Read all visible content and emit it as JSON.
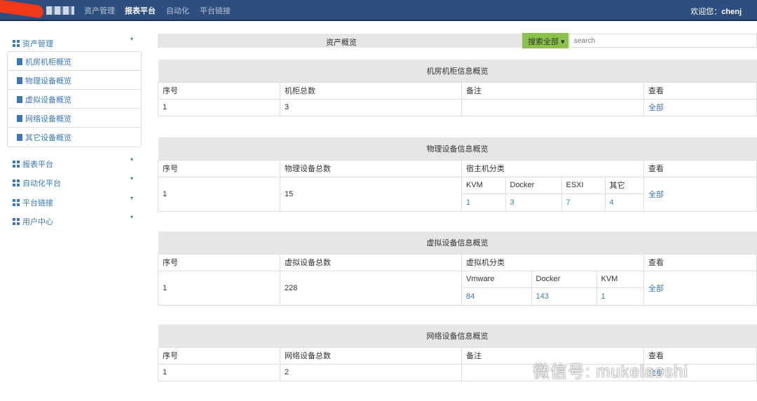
{
  "nav": {
    "items": [
      "资产管理",
      "报表平台",
      "自动化",
      "平台链接"
    ],
    "active": 1,
    "welcome_label": "欢迎您：",
    "user": "chenj"
  },
  "sidebar": {
    "groups": [
      {
        "label": "资产管理",
        "items": [
          "机房机柜概览",
          "物理设备概览",
          "虚拟设备概览",
          "网络设备概览",
          "其它设备概览"
        ]
      },
      {
        "label": "报表平台"
      },
      {
        "label": "自动化平台"
      },
      {
        "label": "平台链接"
      },
      {
        "label": "用户中心"
      }
    ]
  },
  "overview": {
    "title": "资产概览",
    "search_button": "搜索全部",
    "search_placeholder": "search"
  },
  "cabinet": {
    "title": "机房机柜信息概览",
    "headers": [
      "序号",
      "机柜总数",
      "备注",
      "查看"
    ],
    "row": {
      "no": "1",
      "total": "3",
      "note": "",
      "view": "全部"
    }
  },
  "physical": {
    "title": "物理设备信息概览",
    "headers": [
      "序号",
      "物理设备总数",
      "宿主机分类",
      "查看"
    ],
    "row": {
      "no": "1",
      "total": "15",
      "view": "全部"
    },
    "sub_headers": [
      "KVM",
      "Docker",
      "ESXI",
      "其它"
    ],
    "sub_values": [
      "1",
      "3",
      "7",
      "4"
    ]
  },
  "virtual": {
    "title": "虚拟设备信息概览",
    "headers": [
      "序号",
      "虚拟设备总数",
      "虚拟机分类",
      "查看"
    ],
    "row": {
      "no": "1",
      "total": "228",
      "view": "全部"
    },
    "sub_headers": [
      "Vmware",
      "Docker",
      "KVM"
    ],
    "sub_values": [
      "84",
      "143",
      "1"
    ]
  },
  "network": {
    "title": "网络设备信息概览",
    "headers": [
      "序号",
      "网络设备总数",
      "备注",
      "查看"
    ],
    "row": {
      "no": "1",
      "total": "2",
      "note": "",
      "view": "全部"
    }
  },
  "watermark": "微信号: mukelaoshi",
  "colors": {
    "nav": "#2d4f80",
    "link": "#3a78b8",
    "search_button": "#8bc34a"
  }
}
